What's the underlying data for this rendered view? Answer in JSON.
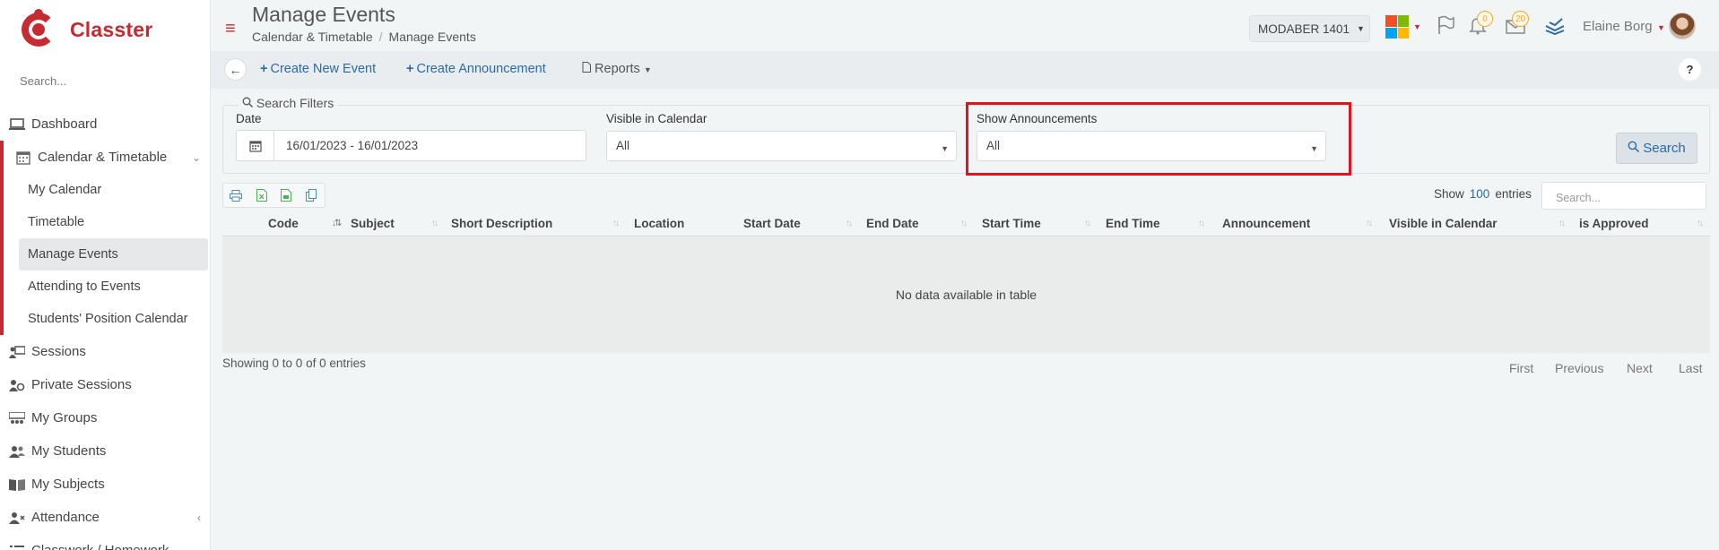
{
  "brand": {
    "name": "Classter",
    "color": "#c62a32"
  },
  "sidebar": {
    "search_placeholder": "Search...",
    "items": [
      {
        "label": "Dashboard",
        "icon": "laptop-icon"
      },
      {
        "label": "Calendar & Timetable",
        "icon": "calendar-icon",
        "expanded": true,
        "children": [
          {
            "label": "My Calendar"
          },
          {
            "label": "Timetable"
          },
          {
            "label": "Manage Events",
            "current": true
          },
          {
            "label": "Attending to Events"
          },
          {
            "label": "Students' Position Calendar"
          }
        ]
      },
      {
        "label": "Sessions",
        "icon": "presentation-icon"
      },
      {
        "label": "Private Sessions",
        "icon": "users-cog-icon"
      },
      {
        "label": "My Groups",
        "icon": "group-icon"
      },
      {
        "label": "My Students",
        "icon": "students-icon"
      },
      {
        "label": "My Subjects",
        "icon": "book-icon"
      },
      {
        "label": "Attendance",
        "icon": "user-x-icon"
      },
      {
        "label": "Classwork / Homework",
        "icon": "list-icon"
      }
    ]
  },
  "header": {
    "title": "Manage Events",
    "breadcrumb": [
      "Calendar & Timetable",
      "Manage Events"
    ],
    "year": "MODABER 1401",
    "notifications_count": "0",
    "messages_count": "20",
    "user_name": "Elaine Borg"
  },
  "toolbar": {
    "create_event": "Create New Event",
    "create_announcement": "Create Announcement",
    "reports": "Reports",
    "help": "?"
  },
  "filters": {
    "legend": "Search Filters",
    "date_label": "Date",
    "date_value": "16/01/2023 - 16/01/2023",
    "visible_label": "Visible in Calendar",
    "visible_value": "All",
    "announcements_label": "Show Announcements",
    "announcements_value": "All",
    "search_button": "Search"
  },
  "table": {
    "show_label": "Show",
    "page_size": "100",
    "entries_label": "entries",
    "search_placeholder": "Search...",
    "columns": [
      "Code",
      "Subject",
      "Short Description",
      "Location",
      "Start Date",
      "End Date",
      "Start Time",
      "End Time",
      "Announcement",
      "Visible in Calendar",
      "is Approved"
    ],
    "empty_message": "No data available in table",
    "info": "Showing 0 to 0 of 0 entries",
    "pager": [
      "First",
      "Previous",
      "Next",
      "Last"
    ]
  },
  "colors": {
    "accent_red": "#c62a32",
    "link_blue": "#2c6aa0",
    "badge_orange": "#f0a830",
    "highlight_red": "#e0141e"
  }
}
